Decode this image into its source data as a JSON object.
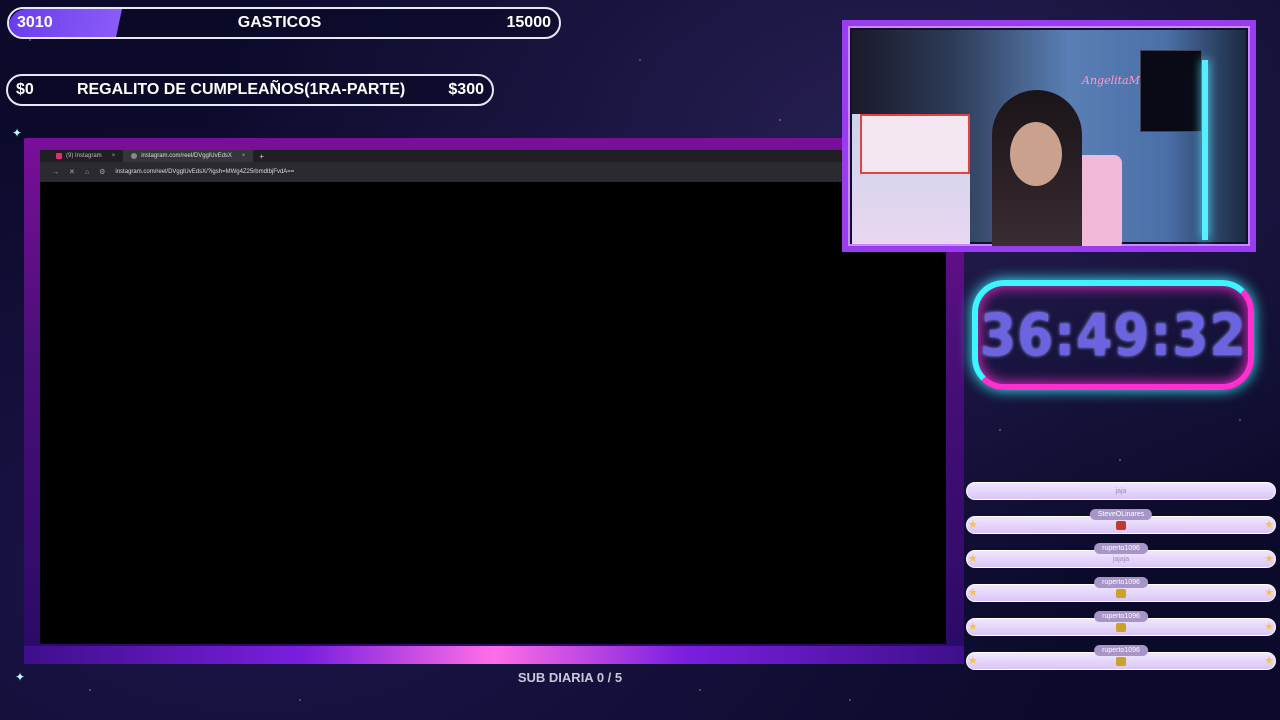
{
  "goals": [
    {
      "current": "3010",
      "title": "GASTICOS",
      "target": "15000",
      "progress": 0.2
    },
    {
      "current": "$0",
      "title": "REGALITO DE CUMPLEAÑOS(1RA-PARTE)",
      "target": "$300",
      "progress": 0
    }
  ],
  "browser": {
    "tabs": [
      {
        "label": "(9) Instagram",
        "icon": "instagram-icon"
      },
      {
        "label": "instagram.com/reel/DVgglUvEdsX",
        "icon": "globe-icon"
      }
    ],
    "new_tab": "+",
    "url": "instagram.com/reel/DVgglUvEdsX/?igsh=MWg4Z25rbmdtbjFvdA=="
  },
  "sub_goal": "SUB DIARIA 0 / 5",
  "camera": {
    "sign": "AngelitaM"
  },
  "timer": "36:49:32",
  "chat": [
    {
      "user": "",
      "text": "jaja"
    },
    {
      "user": "SteveOLinares",
      "text": "",
      "emote_color": "#c0392b"
    },
    {
      "user": "ruperto1096",
      "text": "jajaja"
    },
    {
      "user": "ruperto1096",
      "text": "",
      "emote_color": "#c9a227"
    },
    {
      "user": "ruperto1096",
      "text": "",
      "emote_color": "#c9a227"
    },
    {
      "user": "ruperto1096",
      "text": "",
      "emote_color": "#c9a227"
    }
  ],
  "colors": {
    "goal_fill": "#6a3cf0",
    "frame": "#7a0f9a",
    "timer_cyan": "#3df5ff",
    "timer_pink": "#ff2fd0"
  }
}
